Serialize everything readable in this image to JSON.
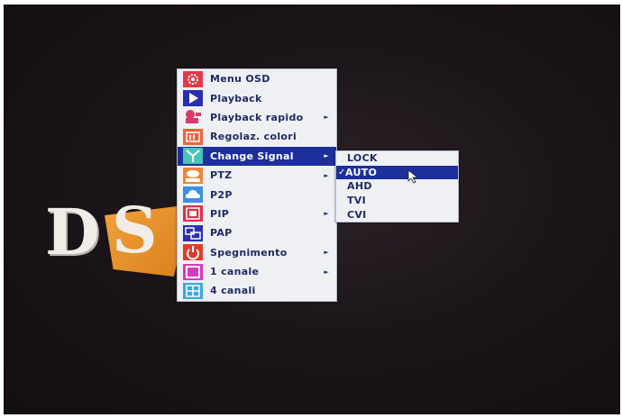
{
  "logo": {
    "letter_d": "D",
    "letter_s": "S",
    "accent_color": "#e8922c"
  },
  "menu": {
    "items": [
      {
        "label": "Menu OSD",
        "icon": "menu-osd-icon",
        "icon_color": "#e23a4a",
        "has_submenu": false
      },
      {
        "label": "Playback",
        "icon": "play-icon",
        "icon_color": "#2a2fb0",
        "has_submenu": false
      },
      {
        "label": "Playback rapido",
        "icon": "fast-playback-icon",
        "icon_color": "#d93a6a",
        "has_submenu": true
      },
      {
        "label": "Regolaz. colori",
        "icon": "color-adjust-icon",
        "icon_color": "#f0643c",
        "has_submenu": false
      },
      {
        "label": "Change Signal",
        "icon": "signal-antenna-icon",
        "icon_color": "#46c4b4",
        "has_submenu": true,
        "active": true
      },
      {
        "label": "PTZ",
        "icon": "ptz-icon",
        "icon_color": "#f0853a",
        "has_submenu": true
      },
      {
        "label": "P2P",
        "icon": "cloud-icon",
        "icon_color": "#3c8fe0",
        "has_submenu": false
      },
      {
        "label": "PIP",
        "icon": "pip-icon",
        "icon_color": "#e0304a",
        "has_submenu": true
      },
      {
        "label": "PAP",
        "icon": "pap-icon",
        "icon_color": "#2a2fb0",
        "has_submenu": false
      },
      {
        "label": "Spegnimento",
        "icon": "power-icon",
        "icon_color": "#e23a2a",
        "has_submenu": true
      },
      {
        "label": "1 canale",
        "icon": "single-channel-icon",
        "icon_color": "#d63ac0",
        "has_submenu": true
      },
      {
        "label": "4 canali",
        "icon": "quad-channel-icon",
        "icon_color": "#3aa8e0",
        "has_submenu": false
      }
    ],
    "submenu_arrow": "►"
  },
  "submenu": {
    "items": [
      {
        "label": "LOCK",
        "checked": false
      },
      {
        "label": "AUTO",
        "checked": true
      },
      {
        "label": "AHD",
        "checked": false
      },
      {
        "label": "TVI",
        "checked": false
      },
      {
        "label": "CVI",
        "checked": false
      }
    ],
    "check_mark": "✓"
  },
  "colors": {
    "highlight": "#1d2f9a",
    "menu_bg": "#eef0f4",
    "menu_text": "#1f2a66"
  }
}
